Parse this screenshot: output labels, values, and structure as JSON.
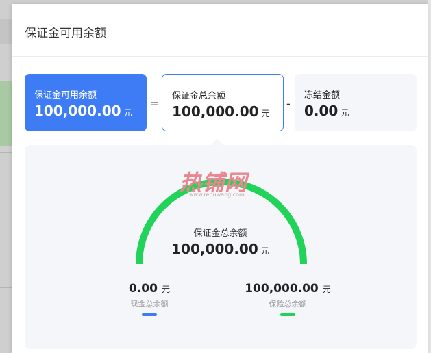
{
  "panel": {
    "title": "保证金可用余额"
  },
  "cards": {
    "available": {
      "label": "保证金可用余额",
      "amount": "100,000.00",
      "unit": "元"
    },
    "total": {
      "label": "保证金总余额",
      "amount": "100,000.00",
      "unit": "元"
    },
    "frozen": {
      "label": "冻结金额",
      "amount": "0.00",
      "unit": "元"
    }
  },
  "operators": {
    "equals": "=",
    "minus": "-"
  },
  "watermark": {
    "text": "热铺网",
    "url": "www.repuwang.com"
  },
  "gauge": {
    "label": "保证金总余额",
    "amount": "100,000.00",
    "unit": "元",
    "fill_fraction": 1.0,
    "color": "#22d35a"
  },
  "breakdown": {
    "cash": {
      "amount": "0.00",
      "unit": "元",
      "label": "现金总余额",
      "color": "#3e7cf6"
    },
    "insurance": {
      "amount": "100,000.00",
      "unit": "元",
      "label": "保险总余额",
      "color": "#22d35a"
    }
  },
  "colors": {
    "primary": "#3e7cf6",
    "success": "#22d35a",
    "card_bg": "#f4f6f9"
  }
}
